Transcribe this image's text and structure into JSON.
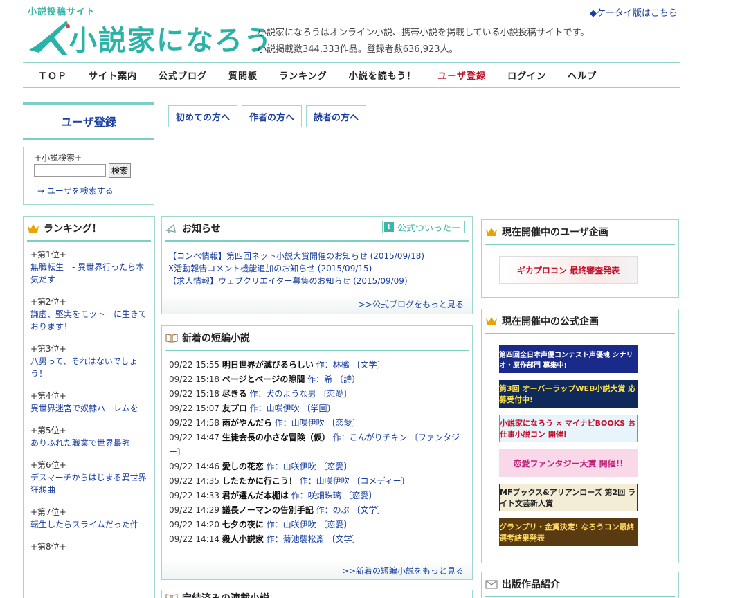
{
  "header": {
    "tagline": "小説投稿サイト",
    "logo_text": "小説家になろう",
    "mobile_link": "◆ケータイ版はこちら",
    "description_1": "小説家になろうはオンライン小説、携帯小説を掲載している小説投稿サイトです。",
    "description_2": "小説掲載数344,333作品。登録者数636,923人。"
  },
  "nav": [
    "ＴＯＰ",
    "サイト案内",
    "公式ブログ",
    "質問板",
    "ランキング",
    "小説を読もう！",
    "ユーザ登録",
    "ログイン",
    "ヘルプ"
  ],
  "sidebar": {
    "register_title": "ユーザ登録",
    "search_label": "+小説検索+",
    "search_button": "検索",
    "user_search": "→ ユーザを検索する"
  },
  "tabs": [
    "初めての方へ",
    "作者の方へ",
    "読者の方へ"
  ],
  "ranking": {
    "title": "ランキング！",
    "items": [
      {
        "pos": "+第1位+",
        "title": "無職転生　- 異世界行ったら本気だす -"
      },
      {
        "pos": "+第2位+",
        "title": "謙虚、堅実をモットーに生きております！"
      },
      {
        "pos": "+第3位+",
        "title": "八男って、それはないでしょう！"
      },
      {
        "pos": "+第4位+",
        "title": "異世界迷宮で奴隷ハーレムを"
      },
      {
        "pos": "+第5位+",
        "title": "ありふれた職業で世界最強"
      },
      {
        "pos": "+第6位+",
        "title": "デスマーチからはじまる異世界狂想曲"
      },
      {
        "pos": "+第7位+",
        "title": "転生したらスライムだった件"
      },
      {
        "pos": "+第8位+",
        "title": ""
      }
    ]
  },
  "news": {
    "title": "お知らせ",
    "twitter": "公式ついったー",
    "items": [
      "【コンペ情報】第四回ネット小説大賞開催のお知らせ (2015/09/18)",
      "X活動報告コメント機能追加のお知らせ (2015/09/15)",
      "【求人情報】ウェブクリエイター募集のお知らせ (2015/09/09)"
    ],
    "more": ">>公式ブログをもっと見る"
  },
  "short_novels": {
    "title": "新着の短編小説",
    "more": ">>新着の短編小説をもっと見る",
    "items": [
      {
        "time": "09/22 15:55",
        "title": "明日世界が滅びるらしい",
        "author": "作：林檎",
        "genre": "〔文学〕"
      },
      {
        "time": "09/22 15:18",
        "title": "ページとページの隙間",
        "author": "作：希",
        "genre": "〔詩〕"
      },
      {
        "time": "09/22 15:18",
        "title": "尽きる",
        "author": "作：犬のような男",
        "genre": "〔恋愛〕"
      },
      {
        "time": "09/22 15:07",
        "title": "友プロ",
        "author": "作：山咲伊吹",
        "genre": "〔学園〕"
      },
      {
        "time": "09/22 14:58",
        "title": "雨がやんだら",
        "author": "作：山咲伊吹",
        "genre": "〔恋愛〕"
      },
      {
        "time": "09/22 14:47",
        "title": "生徒会長の小さな冒険（仮）",
        "author": "作：こんがりチキン",
        "genre": "〔ファンタジー〕"
      },
      {
        "time": "09/22 14:46",
        "title": "愛しの花恋",
        "author": "作：山咲伊吹",
        "genre": "〔恋愛〕"
      },
      {
        "time": "09/22 14:35",
        "title": "したたかに行こう！",
        "author": "作：山咲伊吹",
        "genre": "〔コメディー〕"
      },
      {
        "time": "09/22 14:33",
        "title": "君が選んだ本棚は",
        "author": "作：咲畑珠璃",
        "genre": "〔恋愛〕"
      },
      {
        "time": "09/22 14:29",
        "title": "議長ノーマンの告別手記",
        "author": "作：のぶ",
        "genre": "〔文学〕"
      },
      {
        "time": "09/22 14:20",
        "title": "七夕の夜に",
        "author": "作：山咲伊吹",
        "genre": "〔恋愛〕"
      },
      {
        "time": "09/22 14:14",
        "title": "殺人小説家",
        "author": "作：菊池襲松斎",
        "genre": "〔文学〕"
      }
    ]
  },
  "next_section": {
    "title": "完結済みの連載小説"
  },
  "right": {
    "user_event_title": "現在開催中のユーザ企画",
    "user_banner": "ギカプロコン 最終審査発表",
    "official_event_title": "現在開催中の公式企画",
    "official_banners": [
      "第四回全日本声優コンテスト声優魂 シナリオ・原作部門 募集中!",
      "第3回 オーバーラップWEB小説大賞 応募受付中!",
      "小説家になろう × マイナビBOOKS お仕事小説コン 開催!",
      "恋愛ファンタジー大賞 開催!!",
      "MFブックス&アリアンローズ 第2回 ライト文芸新人賞",
      "グランプリ・金賞決定! なろうコン最終選考結果発表"
    ],
    "publish_title": "出版作品紹介"
  }
}
